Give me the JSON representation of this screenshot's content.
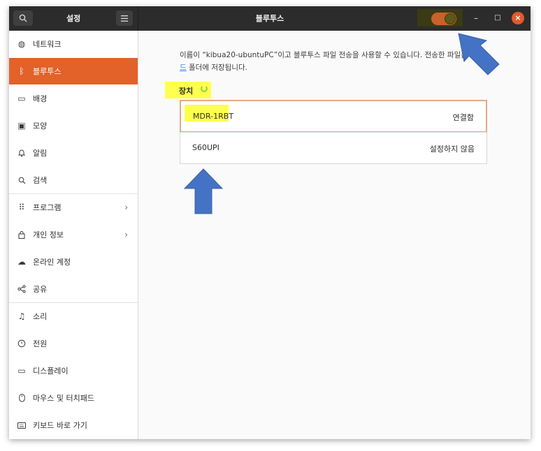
{
  "titlebar": {
    "left_title": "설정",
    "title": "블루투스",
    "search_icon": "search-icon",
    "menu_icon": "hamburger-menu-icon",
    "bluetooth_enabled": true,
    "minimize": "–",
    "maximize": "□",
    "close": "×"
  },
  "sidebar": {
    "items": [
      {
        "label": "네트워크",
        "icon": "network-globe-icon",
        "glyph": "◍"
      },
      {
        "label": "블루투스",
        "icon": "bluetooth-icon",
        "glyph": "ᛒ",
        "active": true
      },
      {
        "label": "배경",
        "icon": "background-monitor-icon",
        "glyph": "▭"
      },
      {
        "label": "모양",
        "icon": "appearance-icon",
        "glyph": "▣"
      },
      {
        "label": "알림",
        "icon": "bell-icon",
        "glyph": "♫"
      },
      {
        "label": "검색",
        "icon": "search-icon",
        "glyph": "⚲"
      },
      {
        "label": "프로그램",
        "icon": "apps-grid-icon",
        "glyph": "⠿",
        "chevron": "›"
      },
      {
        "label": "개인 정보",
        "icon": "lock-icon",
        "glyph": "⊡",
        "chevron": "›"
      },
      {
        "label": "온라인 계정",
        "icon": "cloud-icon",
        "glyph": "☁"
      },
      {
        "label": "공유",
        "icon": "share-icon",
        "glyph": "⋖"
      },
      {
        "label": "소리",
        "icon": "music-note-icon",
        "glyph": "♫"
      },
      {
        "label": "전원",
        "icon": "power-icon",
        "glyph": "⏻"
      },
      {
        "label": "디스플레이",
        "icon": "display-icon",
        "glyph": "▭"
      },
      {
        "label": "마우스 및 터치패드",
        "icon": "mouse-icon",
        "glyph": "◯"
      },
      {
        "label": "키보드 바로 가기",
        "icon": "keyboard-icon",
        "glyph": "⌨"
      }
    ]
  },
  "content": {
    "desc_line1": "이름이 “kibua20-ubuntuPC”이고 블루투스 파일 전송을 사용할 수 있습니다. 전송한 파일은",
    "desc_link_char": "드",
    "desc_line2": "폴더에 저장됩니다.",
    "devices_label": "장치",
    "devices": [
      {
        "name": "MDR-1RBT",
        "status": "연결함"
      },
      {
        "name": "S60UPI",
        "status": "설정하지 않음"
      }
    ]
  },
  "annotations": {
    "arrow_color": "#4472c4",
    "highlight_color": "#ffff4d"
  }
}
